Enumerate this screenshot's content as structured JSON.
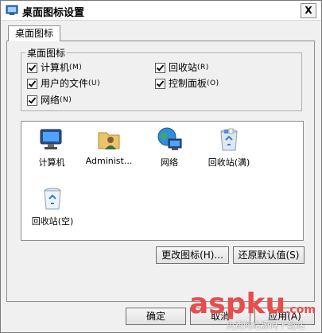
{
  "window": {
    "title": "桌面图标设置",
    "close_label": "X"
  },
  "tabs": [
    {
      "label": "桌面图标"
    }
  ],
  "group": {
    "label": "桌面图标",
    "checkboxes": [
      {
        "label": "计算机",
        "key": "(M)",
        "checked": true
      },
      {
        "label": "回收站",
        "key": "(R)",
        "checked": true
      },
      {
        "label": "用户的文件",
        "key": "(U)",
        "checked": true
      },
      {
        "label": "控制面板",
        "key": "(O)",
        "checked": true
      },
      {
        "label": "网络",
        "key": "(N)",
        "checked": true
      }
    ]
  },
  "icons": [
    {
      "label": "计算机",
      "icon": "computer-icon"
    },
    {
      "label": "Administ...",
      "icon": "user-folder-icon"
    },
    {
      "label": "网络",
      "icon": "network-icon"
    },
    {
      "label": "回收站(满)",
      "icon": "recycle-bin-full-icon"
    },
    {
      "label": "回收站(空)",
      "icon": "recycle-bin-empty-icon"
    }
  ],
  "buttons": {
    "change_icon": "更改图标(H)...",
    "restore_default": "还原默认值(S)",
    "ok": "确定",
    "cancel": "取消",
    "apply": "应用(A)"
  },
  "watermark": {
    "text": "asp",
    "text2": "ku",
    "suffix": ".com",
    "sub": "免费网站源码下载站"
  }
}
